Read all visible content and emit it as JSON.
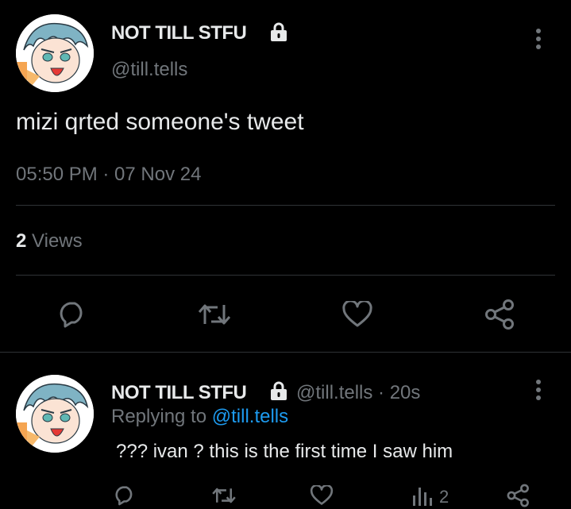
{
  "tweet": {
    "display_name": "NOT TILL STFU",
    "handle": "@till.tells",
    "text": "mizi qrted someone's tweet",
    "timestamp": "05:50 PM · 07 Nov 24",
    "views_count": "2",
    "views_label": "Views"
  },
  "reply": {
    "display_name": "NOT TILL STFU",
    "handle_time": "@till.tells · 20s",
    "replying_prefix": "Replying to",
    "replying_to": "@till.tells",
    "text": "??? ivan ? this is the first time I saw him",
    "analytics_count": "2"
  },
  "icons": {
    "lock": "lock-icon",
    "more": "more-vertical-icon",
    "reply": "reply-icon",
    "retweet": "retweet-icon",
    "like": "heart-icon",
    "share": "share-icon",
    "analytics": "analytics-icon"
  },
  "colors": {
    "background": "#000000",
    "text": "#e7e9ea",
    "secondary": "#71767b",
    "link": "#1d9bf0",
    "divider": "#2f3336"
  }
}
